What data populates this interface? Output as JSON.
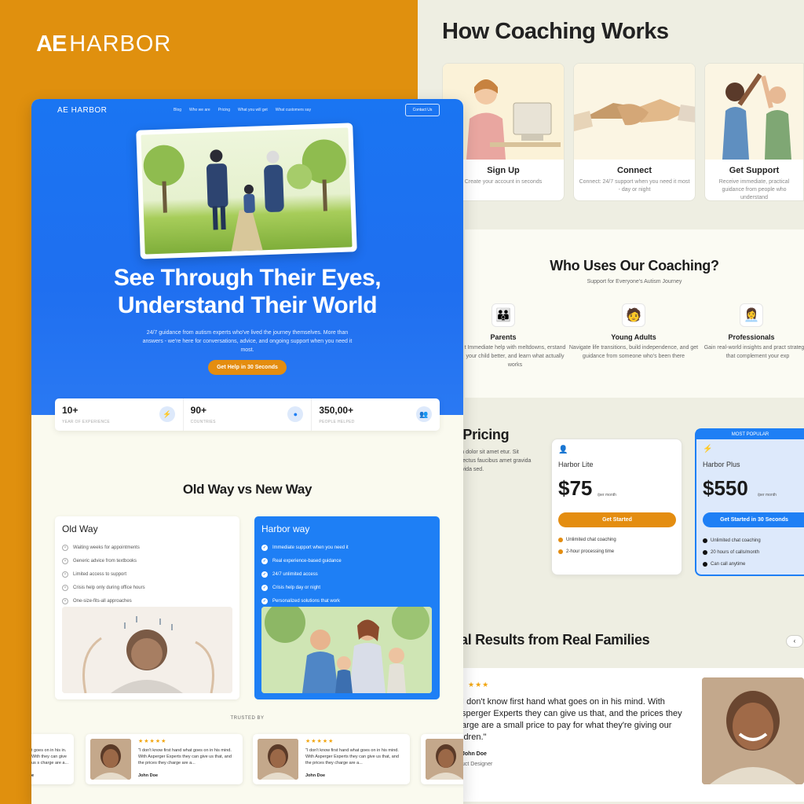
{
  "brand": {
    "mark": "AE",
    "name": "HARBOR"
  },
  "how": {
    "title": "How Coaching Works",
    "cards": [
      {
        "title": "Sign Up",
        "desc": "Create your account in seconds"
      },
      {
        "title": "Connect",
        "desc": "Connect: 24/7 support when you need it most - day or night"
      },
      {
        "title": "Get Support",
        "desc": "Receive immediate, practical guidance from people who understand"
      }
    ]
  },
  "who": {
    "title": "Who Uses Our Coaching?",
    "subtitle": "Support for Everyone's Autism Journey",
    "items": [
      {
        "icon": "parents-icon",
        "title": "Parents",
        "desc": "t Immediate help with meltdowns, erstand your child better, and learn what actually works"
      },
      {
        "icon": "young-adult-icon",
        "title": "Young Adults",
        "desc": "Navigate life transitions, build independence, and get guidance from someone who's been there"
      },
      {
        "icon": "professional-icon",
        "title": "Professionals",
        "desc": "Gain real-world insights and pract strategies that complement your exp"
      }
    ]
  },
  "pricing": {
    "title": "r Pricing",
    "text": "sum dolor sit amet etur. Sit senectus faucibus amet gravida gravida sed.",
    "plans": [
      {
        "name": "Harbor Lite",
        "price": "$75",
        "per": "/per month",
        "cta": "Get Started",
        "features": [
          "Unlimited chat coaching",
          "2-hour processing time"
        ]
      },
      {
        "badge": "MOST POPULAR",
        "name": "Harbor Plus",
        "price": "$550",
        "per": "/per month",
        "cta": "Get Started in 30 Seconds",
        "features": [
          "Unlimited chat coaching",
          "20 hours of calls/month",
          "Can call anytime"
        ]
      }
    ]
  },
  "results": {
    "title": "al Results from Real Families",
    "arrow": "‹",
    "stars": "★★★",
    "quote": "I don't know first hand what goes on in his mind. With sperger Experts they can give us that, and the prices they arge are a small price to pay for what they're giving our ldren.\"",
    "name": "John Doe",
    "role": "uct Designer"
  },
  "mock": {
    "nav_logo_mark": "AE",
    "nav_logo_name": "HARBOR",
    "nav_links": [
      "Blog",
      "Who we are",
      "Pricing",
      "What you will get",
      "What customers say"
    ],
    "contact": "Contact Us",
    "hero_title_1": "See Through Their Eyes,",
    "hero_title_2": "Understand Their World",
    "hero_sub": "24/7 guidance from autism experts who've lived the journey themselves. More than answers - we're here for conversations, advice, and ongoing support when you need it most.",
    "hero_cta": "Get Help in 30 Seconds",
    "stats": [
      {
        "value": "10+",
        "label": "YEAR OF EXPERIENCE",
        "icon": "bolt-icon"
      },
      {
        "value": "90+",
        "label": "COUNTRIES",
        "icon": "globe-icon"
      },
      {
        "value": "350,00+",
        "label": "PEOPLE HELPED",
        "icon": "people-icon"
      }
    ],
    "compare_title": "Old Way vs New Way",
    "old": {
      "title": "Old Way",
      "items": [
        "Waiting weeks for appointments",
        "Generic advice from textbooks",
        "Limited access to support",
        "Crisis help only during office hours",
        "One-size-fits-all approaches"
      ]
    },
    "new": {
      "title": "Harbor way",
      "items": [
        "Immediate support when you need it",
        "Real experience-based guidance",
        "24/7 unlimited access",
        "Crisis help day or night",
        "Personalized solutions that work"
      ]
    },
    "trusted": "TRUSTED BY",
    "testimonials": [
      {
        "stars": "★★★★★",
        "quote": "\"I don't know first hand what goes on in his mind. With Asperger Experts they can give us that, and the prices they charge are a...",
        "name": "John Doe"
      },
      {
        "stars": "★★★★★",
        "quote": "\"I don't know first hand what goes on in his mind. With Asperger Experts they can give us that, and the prices they charge are a...",
        "name": "John Doe"
      }
    ],
    "partial_left_quote": "t goes on in his in. With they can give us s charge are a...",
    "partial_left_name": "e"
  }
}
